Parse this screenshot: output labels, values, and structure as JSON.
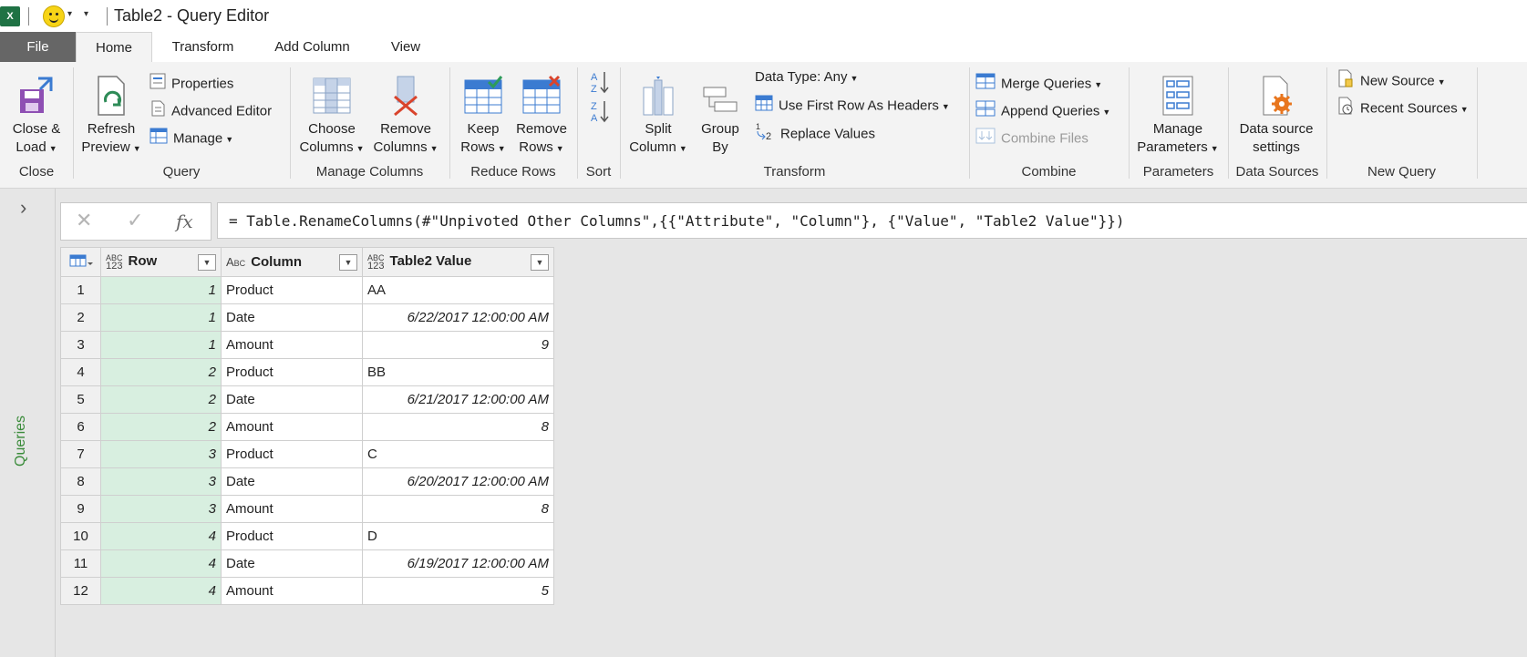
{
  "window": {
    "title": "Table2 - Query Editor",
    "app_icon": "X"
  },
  "tabs": [
    {
      "label": "File"
    },
    {
      "label": "Home"
    },
    {
      "label": "Transform"
    },
    {
      "label": "Add Column"
    },
    {
      "label": "View"
    }
  ],
  "ribbon": {
    "close": {
      "button": "Close &\nLoad",
      "line1": "Close &",
      "line2": "Load",
      "group": "Close"
    },
    "query": {
      "refresh_line1": "Refresh",
      "refresh_line2": "Preview",
      "properties": "Properties",
      "advanced_editor": "Advanced Editor",
      "manage": "Manage",
      "group": "Query"
    },
    "manage_columns": {
      "choose_line1": "Choose",
      "choose_line2": "Columns",
      "remove_line1": "Remove",
      "remove_line2": "Columns",
      "group": "Manage Columns"
    },
    "reduce_rows": {
      "keep_line1": "Keep",
      "keep_line2": "Rows",
      "remove_line1": "Remove",
      "remove_line2": "Rows",
      "group": "Reduce Rows"
    },
    "sort": {
      "group": "Sort"
    },
    "transform": {
      "split_line1": "Split",
      "split_line2": "Column",
      "group_line1": "Group",
      "group_line2": "By",
      "data_type": "Data Type: Any",
      "first_row_headers": "Use First Row As Headers",
      "replace_values": "Replace Values",
      "group": "Transform"
    },
    "combine": {
      "merge": "Merge Queries",
      "append": "Append Queries",
      "combine_files": "Combine Files",
      "group": "Combine"
    },
    "parameters": {
      "line1": "Manage",
      "line2": "Parameters",
      "group": "Parameters"
    },
    "data_sources": {
      "line1": "Data source",
      "line2": "settings",
      "group": "Data Sources"
    },
    "new_query": {
      "new_source": "New Source",
      "recent_sources": "Recent Sources",
      "group": "New Query"
    }
  },
  "left_pane": {
    "label": "Queries"
  },
  "formula_bar": {
    "formula": "= Table.RenameColumns(#\"Unpivoted Other Columns\",{{\"Attribute\", \"Column\"}, {\"Value\", \"Table2 Value\"}})",
    "cancel_glyph": "✕",
    "commit_glyph": "✓",
    "fx": "fx"
  },
  "table": {
    "columns": [
      {
        "name": "Row",
        "type_top": "ABC",
        "type_bottom": "123"
      },
      {
        "name": "Column",
        "type_top": "A",
        "type_bottom": "BC"
      },
      {
        "name": "Table2 Value",
        "type_top": "ABC",
        "type_bottom": "123"
      }
    ],
    "rows": [
      {
        "n": "1",
        "row": "1",
        "column": "Product",
        "value": "AA",
        "numeric": false
      },
      {
        "n": "2",
        "row": "1",
        "column": "Date",
        "value": "6/22/2017 12:00:00 AM",
        "numeric": true
      },
      {
        "n": "3",
        "row": "1",
        "column": "Amount",
        "value": "9",
        "numeric": true
      },
      {
        "n": "4",
        "row": "2",
        "column": "Product",
        "value": "BB",
        "numeric": false
      },
      {
        "n": "5",
        "row": "2",
        "column": "Date",
        "value": "6/21/2017 12:00:00 AM",
        "numeric": true
      },
      {
        "n": "6",
        "row": "2",
        "column": "Amount",
        "value": "8",
        "numeric": true
      },
      {
        "n": "7",
        "row": "3",
        "column": "Product",
        "value": "C",
        "numeric": false
      },
      {
        "n": "8",
        "row": "3",
        "column": "Date",
        "value": "6/20/2017 12:00:00 AM",
        "numeric": true
      },
      {
        "n": "9",
        "row": "3",
        "column": "Amount",
        "value": "8",
        "numeric": true
      },
      {
        "n": "10",
        "row": "4",
        "column": "Product",
        "value": "D",
        "numeric": false
      },
      {
        "n": "11",
        "row": "4",
        "column": "Date",
        "value": "6/19/2017 12:00:00 AM",
        "numeric": true
      },
      {
        "n": "12",
        "row": "4",
        "column": "Amount",
        "value": "5",
        "numeric": true
      }
    ]
  },
  "colors": {
    "excel_green": "#1f7244",
    "row_highlight": "#d8efe0",
    "queries_green": "#3a8b3a",
    "file_tab": "#666666"
  },
  "icons": [
    "excel-icon",
    "smiley-icon",
    "close-load-icon",
    "refresh-icon",
    "properties-icon",
    "advanced-editor-icon",
    "manage-icon",
    "choose-columns-icon",
    "remove-columns-icon",
    "keep-rows-icon",
    "remove-rows-icon",
    "sort-ascending-icon",
    "sort-descending-icon",
    "split-column-icon",
    "group-by-icon",
    "use-first-row-icon",
    "replace-values-icon",
    "merge-queries-icon",
    "append-queries-icon",
    "combine-files-icon",
    "manage-parameters-icon",
    "data-source-settings-icon",
    "new-source-icon",
    "recent-sources-icon",
    "chevron-right-icon",
    "table-menu-icon"
  ]
}
